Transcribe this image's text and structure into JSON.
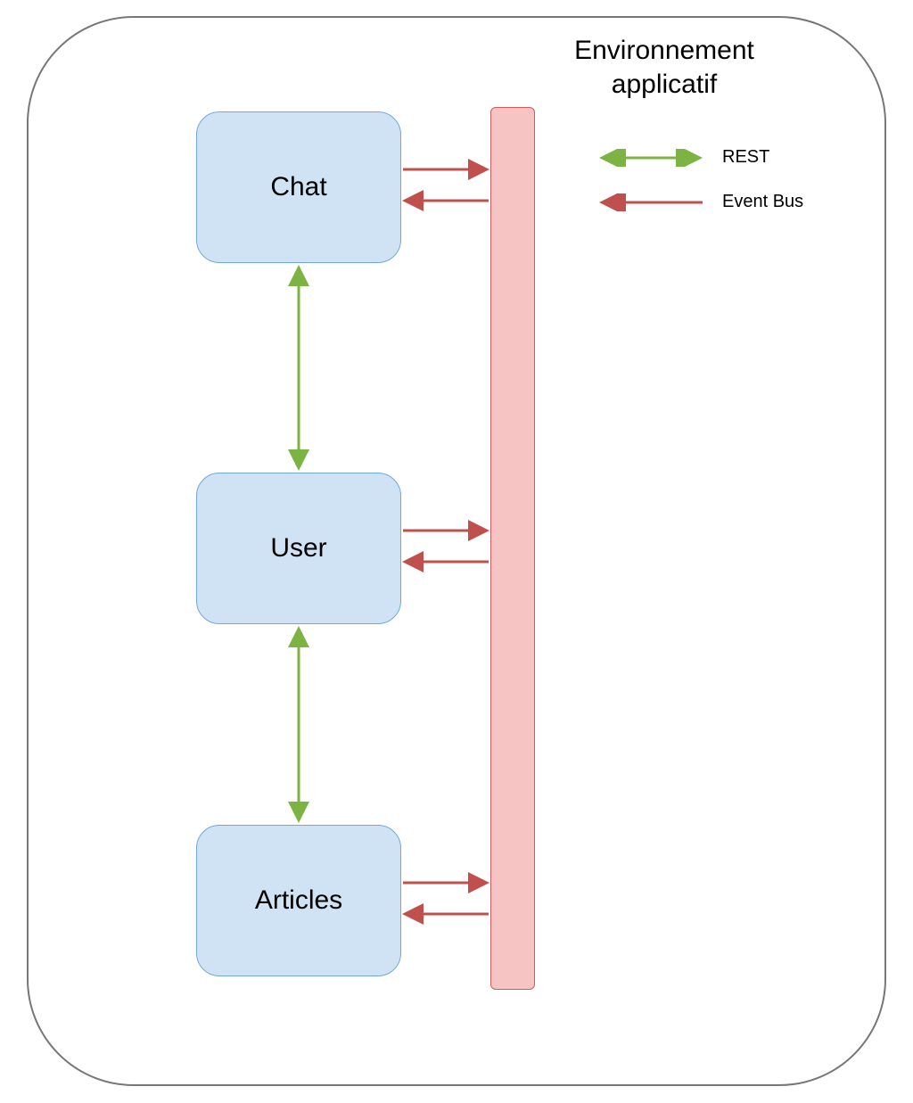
{
  "title_line1": "Environnement",
  "title_line2": "applicatif",
  "services": {
    "chat": "Chat",
    "user": "User",
    "articles": "Articles"
  },
  "legend": {
    "rest": "REST",
    "eventbus": "Event Bus"
  },
  "colors": {
    "service_fill": "#d0e3f5",
    "service_stroke": "#6fa8dc",
    "bus_fill": "#f6c4c2",
    "bus_stroke": "#d35a5a",
    "arrow_green": "#7cb342",
    "arrow_red": "#c0504d"
  }
}
